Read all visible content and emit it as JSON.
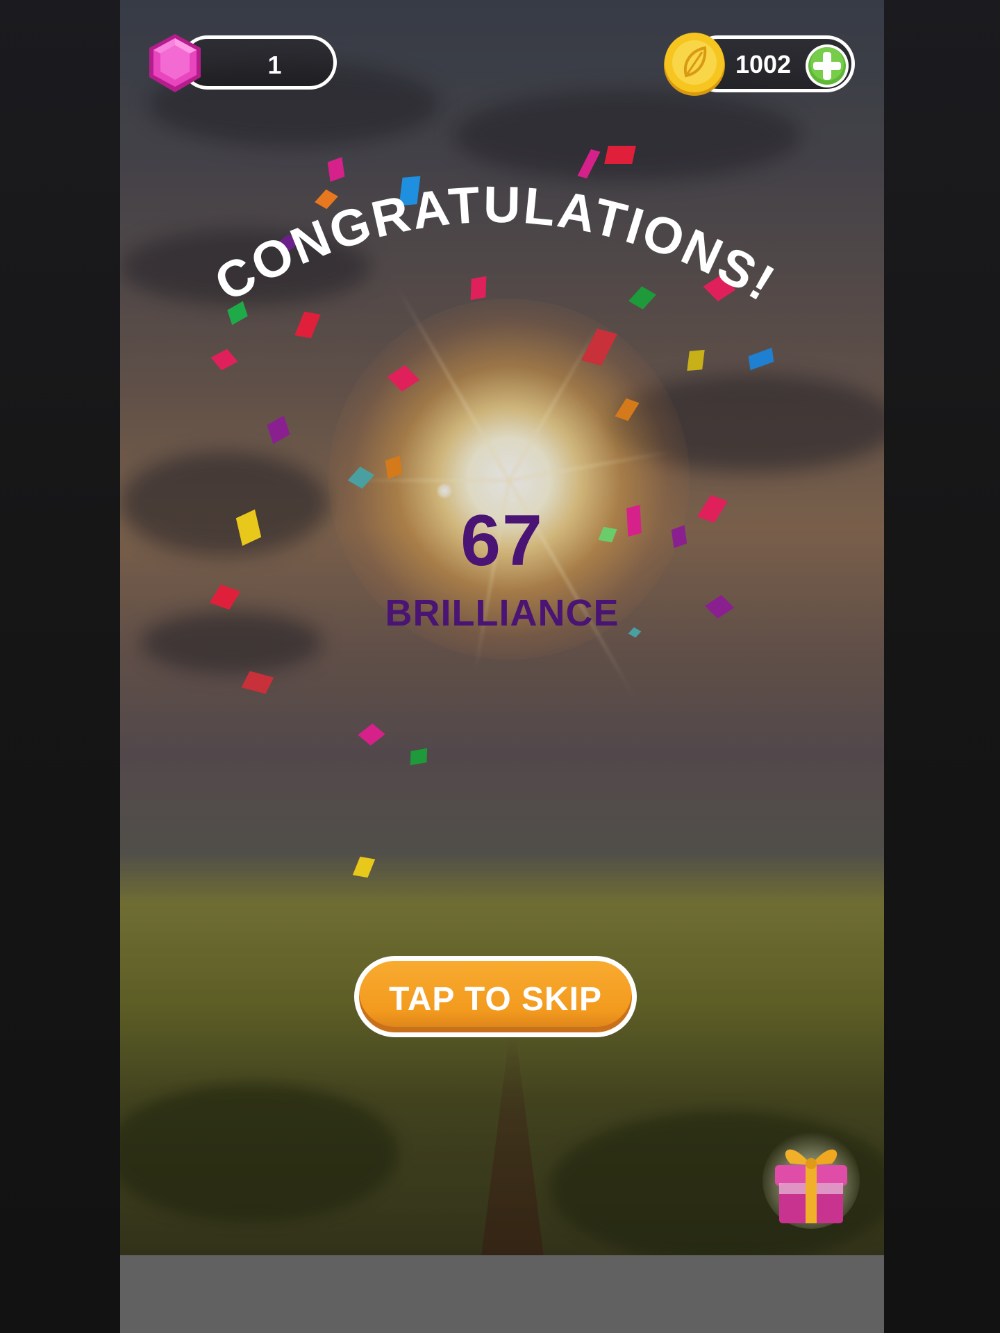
{
  "hud": {
    "gems": {
      "value": "1",
      "icon": "gem-icon"
    },
    "coins": {
      "value": "1002",
      "icon": "leaf-coin-icon",
      "add_icon": "plus-icon"
    }
  },
  "celebration": {
    "title": "CONGRATULATIONS!",
    "score": "67",
    "score_label": "BRILLIANCE"
  },
  "actions": {
    "skip_label": "TAP TO SKIP"
  },
  "reward": {
    "icon": "gift-icon"
  },
  "colors": {
    "score_text": "#4a1475",
    "skip_button": "#f29a1e",
    "gem": "#e03bb7",
    "coin": "#f5c21d",
    "plus": "#5fb936"
  }
}
